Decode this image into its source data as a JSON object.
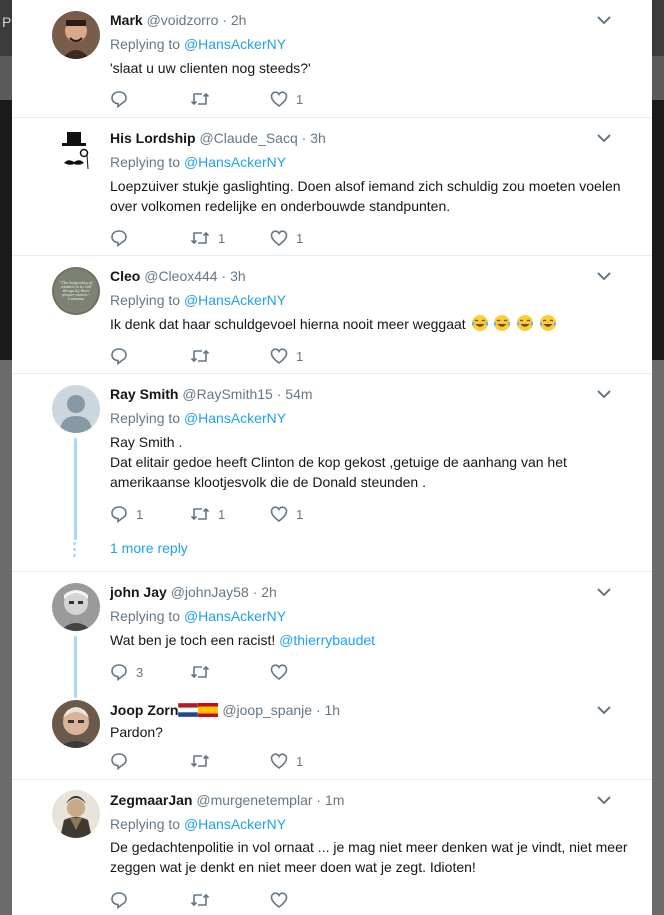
{
  "background": {
    "left_text": "P"
  },
  "colors": {
    "link": "#1da1f2",
    "muted": "#657786",
    "thread": "#a7d7f5"
  },
  "icons": {
    "reply": "reply-icon",
    "retweet": "retweet-icon",
    "like": "heart-icon",
    "menu": "chevron-down-icon"
  },
  "tweets": [
    {
      "name": "Mark",
      "handle": "@voidzorro",
      "time": "2h",
      "replying_prefix": "Replying to",
      "replying_to": "@HansAckerNY",
      "text": "'slaat u uw clienten nog steeds?'",
      "replies": "",
      "retweets": "",
      "likes": "1"
    },
    {
      "name": "His Lordship",
      "handle": "@Claude_Sacq",
      "time": "3h",
      "replying_prefix": "Replying to",
      "replying_to": "@HansAckerNY",
      "text": "Loepzuiver stukje gaslighting. Doen alsof iemand zich schuldig zou moeten voelen over volkomen redelijke en onderbouwde standpunten.",
      "replies": "",
      "retweets": "1",
      "likes": "1"
    },
    {
      "name": "Cleo",
      "handle": "@Cleox444",
      "time": "3h",
      "replying_prefix": "Replying to",
      "replying_to": "@HansAckerNY",
      "text": "Ik denk dat haar schuldgevoel hierna nooit meer weggaat",
      "emoji": "face-with-tears-of-joy x4",
      "avatar_text": "\"The beginning of wisdom is to call things by their proper names.\" Confucius",
      "replies": "",
      "retweets": "",
      "likes": "1"
    },
    {
      "name": "Ray Smith",
      "handle": "@RaySmith15",
      "time": "54m",
      "replying_prefix": "Replying to",
      "replying_to": "@HansAckerNY",
      "text_line1": "Ray Smith .",
      "text_line2": "Dat elitair gedoe heeft Clinton de kop gekost ,getuige de aanhang van het amerikaanse klootjesvolk die de Donald steunden .",
      "replies": "1",
      "retweets": "1",
      "likes": "1",
      "more_reply": "1 more reply"
    },
    {
      "name": "john Jay",
      "handle": "@johnJay58",
      "time": "2h",
      "replying_prefix": "Replying to",
      "replying_to": "@HansAckerNY",
      "text": "Wat ben je toch een racist!",
      "mention": "@thierrybaudet",
      "replies": "3",
      "retweets": "",
      "likes": ""
    },
    {
      "name": "Joop Zorn",
      "handle": "@joop_spanje",
      "time": "1h",
      "flags": "Netherlands and Spain flags",
      "text": "Pardon?",
      "replies": "",
      "retweets": "",
      "likes": "1"
    },
    {
      "name": "ZegmaarJan",
      "handle": "@murgenetemplar",
      "time": "1m",
      "replying_prefix": "Replying to",
      "replying_to": "@HansAckerNY",
      "text": "De gedachtenpolitie in vol ornaat ... je mag niet meer denken wat je vindt, niet meer zeggen wat je denkt en niet meer doen wat je zegt. Idioten!",
      "replies": "",
      "retweets": "",
      "likes": ""
    }
  ]
}
